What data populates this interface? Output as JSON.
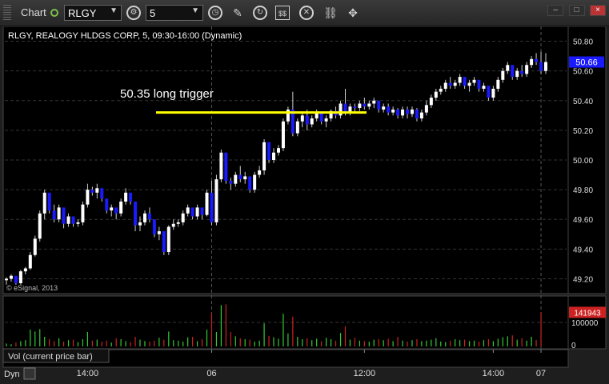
{
  "toolbar": {
    "chart_label": "Chart",
    "symbol": "RLGY",
    "interval": "5",
    "icons": [
      "settings-gear-icon",
      "clock-icon",
      "pencil-icon",
      "refresh-icon",
      "quote-icon",
      "close-circle-icon",
      "link-icon"
    ]
  },
  "window_buttons": [
    "–",
    "□",
    "×"
  ],
  "chart_data": {
    "type": "candlestick",
    "title": "RLGY, REALOGY HLDGS CORP, 5, 09:30-16:00 (Dynamic)",
    "annotation": "50.35 long trigger",
    "trigger_price": 50.32,
    "copyright": "© eSignal, 2013",
    "last_price": "50.66",
    "last_price_value": 50.66,
    "ylim": [
      49.1,
      50.9
    ],
    "y_ticks": [
      "50.80",
      "50.60",
      "50.40",
      "50.20",
      "50.00",
      "49.80",
      "49.60",
      "49.40",
      "49.20"
    ],
    "x_ticks": [
      "14:00",
      "06",
      "12:00",
      "14:00",
      "07"
    ],
    "day_separators": [
      "06",
      "07"
    ],
    "colors": {
      "up": "#ffffff",
      "down": "#1a1aff",
      "trigger": "#ffff00",
      "last_price_box": "#1a1aff",
      "vol_up": "#33cc33",
      "vol_down": "#cc2222"
    },
    "candles": [
      [
        49.19,
        49.21,
        49.16,
        49.2
      ],
      [
        49.2,
        49.23,
        49.18,
        49.22
      ],
      [
        49.22,
        49.21,
        49.16,
        49.17
      ],
      [
        49.17,
        49.26,
        49.16,
        49.25
      ],
      [
        49.25,
        49.28,
        49.23,
        49.27
      ],
      [
        49.27,
        49.38,
        49.26,
        49.36
      ],
      [
        49.36,
        49.49,
        49.35,
        49.47
      ],
      [
        49.47,
        49.66,
        49.45,
        49.64
      ],
      [
        49.64,
        49.8,
        49.6,
        49.78
      ],
      [
        49.78,
        49.74,
        49.64,
        49.66
      ],
      [
        49.66,
        49.7,
        49.58,
        49.6
      ],
      [
        49.6,
        49.7,
        49.58,
        49.68
      ],
      [
        49.68,
        49.6,
        49.54,
        49.57
      ],
      [
        49.57,
        49.64,
        49.55,
        49.62
      ],
      [
        49.62,
        49.6,
        49.55,
        49.57
      ],
      [
        49.57,
        49.6,
        49.55,
        49.58
      ],
      [
        49.58,
        49.72,
        49.56,
        49.7
      ],
      [
        49.7,
        49.84,
        49.68,
        49.8
      ],
      [
        49.8,
        49.82,
        49.76,
        49.78
      ],
      [
        49.78,
        49.84,
        49.74,
        49.81
      ],
      [
        49.81,
        49.8,
        49.72,
        49.74
      ],
      [
        49.74,
        49.72,
        49.64,
        49.66
      ],
      [
        49.66,
        49.7,
        49.62,
        49.68
      ],
      [
        49.68,
        49.66,
        49.6,
        49.64
      ],
      [
        49.64,
        49.74,
        49.62,
        49.72
      ],
      [
        49.72,
        49.81,
        49.7,
        49.78
      ],
      [
        49.78,
        49.76,
        49.7,
        49.72
      ],
      [
        49.72,
        49.7,
        49.52,
        49.56
      ],
      [
        49.56,
        49.62,
        49.52,
        49.58
      ],
      [
        49.58,
        49.66,
        49.56,
        49.64
      ],
      [
        49.64,
        49.68,
        49.58,
        49.6
      ],
      [
        49.6,
        49.58,
        49.48,
        49.5
      ],
      [
        49.5,
        49.55,
        49.46,
        49.52
      ],
      [
        49.52,
        49.5,
        49.36,
        49.38
      ],
      [
        49.38,
        49.56,
        49.36,
        49.55
      ],
      [
        49.55,
        49.6,
        49.53,
        49.57
      ],
      [
        49.57,
        49.6,
        49.55,
        49.58
      ],
      [
        49.58,
        49.66,
        49.56,
        49.64
      ],
      [
        49.64,
        49.7,
        49.62,
        49.68
      ],
      [
        49.68,
        49.66,
        49.6,
        49.62
      ],
      [
        49.62,
        49.7,
        49.6,
        49.68
      ],
      [
        49.68,
        49.66,
        49.6,
        49.63
      ],
      [
        49.63,
        49.8,
        49.62,
        49.78
      ],
      [
        49.78,
        49.86,
        49.56,
        49.58
      ],
      [
        49.58,
        49.9,
        49.56,
        49.87
      ],
      [
        49.87,
        50.07,
        49.85,
        50.05
      ],
      [
        50.05,
        50.0,
        49.84,
        49.86
      ],
      [
        49.86,
        49.88,
        49.8,
        49.84
      ],
      [
        49.84,
        49.92,
        49.82,
        49.9
      ],
      [
        49.9,
        49.96,
        49.85,
        49.87
      ],
      [
        49.87,
        49.92,
        49.84,
        49.89
      ],
      [
        49.89,
        49.84,
        49.78,
        49.8
      ],
      [
        49.8,
        49.92,
        49.78,
        49.9
      ],
      [
        49.9,
        49.96,
        49.88,
        49.93
      ],
      [
        49.93,
        50.14,
        49.9,
        50.12
      ],
      [
        50.12,
        50.1,
        49.98,
        50.0
      ],
      [
        50.0,
        50.08,
        49.98,
        50.05
      ],
      [
        50.05,
        50.1,
        50.03,
        50.08
      ],
      [
        50.08,
        50.28,
        50.06,
        50.26
      ],
      [
        50.26,
        50.36,
        50.24,
        50.34
      ],
      [
        50.34,
        50.46,
        50.16,
        50.18
      ],
      [
        50.18,
        50.28,
        50.16,
        50.26
      ],
      [
        50.26,
        50.32,
        50.22,
        50.3
      ],
      [
        50.3,
        50.34,
        50.2,
        50.24
      ],
      [
        50.24,
        50.3,
        50.22,
        50.28
      ],
      [
        50.28,
        50.34,
        50.26,
        50.32
      ],
      [
        50.32,
        50.3,
        50.24,
        50.26
      ],
      [
        50.26,
        50.3,
        50.22,
        50.28
      ],
      [
        50.28,
        50.34,
        50.26,
        50.33
      ],
      [
        50.33,
        50.36,
        50.28,
        50.3
      ],
      [
        50.3,
        50.4,
        50.28,
        50.38
      ],
      [
        50.38,
        50.48,
        50.3,
        50.32
      ],
      [
        50.32,
        50.38,
        50.3,
        50.36
      ],
      [
        50.36,
        50.38,
        50.32,
        50.35
      ],
      [
        50.35,
        50.4,
        50.33,
        50.38
      ],
      [
        50.38,
        50.42,
        50.34,
        50.36
      ],
      [
        50.36,
        50.4,
        50.34,
        50.38
      ],
      [
        50.38,
        50.42,
        50.35,
        50.4
      ],
      [
        50.4,
        50.38,
        50.32,
        50.34
      ],
      [
        50.34,
        50.38,
        50.32,
        50.36
      ],
      [
        50.36,
        50.38,
        50.3,
        50.32
      ],
      [
        50.32,
        50.36,
        50.3,
        50.34
      ],
      [
        50.34,
        50.35,
        50.28,
        50.3
      ],
      [
        50.3,
        50.36,
        50.28,
        50.34
      ],
      [
        50.34,
        50.36,
        50.28,
        50.31
      ],
      [
        50.31,
        50.36,
        50.29,
        50.34
      ],
      [
        50.34,
        50.35,
        50.26,
        50.28
      ],
      [
        50.28,
        50.34,
        50.26,
        50.32
      ],
      [
        50.32,
        50.4,
        50.3,
        50.37
      ],
      [
        50.37,
        50.44,
        50.35,
        50.42
      ],
      [
        50.42,
        50.48,
        50.4,
        50.46
      ],
      [
        50.46,
        50.5,
        50.44,
        50.48
      ],
      [
        50.48,
        50.54,
        50.46,
        50.52
      ],
      [
        50.52,
        50.56,
        50.48,
        50.5
      ],
      [
        50.5,
        50.54,
        50.48,
        50.52
      ],
      [
        50.52,
        50.58,
        50.5,
        50.56
      ],
      [
        50.56,
        50.55,
        50.48,
        50.5
      ],
      [
        50.5,
        50.54,
        50.46,
        50.52
      ],
      [
        50.52,
        50.56,
        50.5,
        50.54
      ],
      [
        50.54,
        50.52,
        50.46,
        50.48
      ],
      [
        50.48,
        50.52,
        50.46,
        50.5
      ],
      [
        50.5,
        50.48,
        50.4,
        50.42
      ],
      [
        50.42,
        50.5,
        50.4,
        50.48
      ],
      [
        50.48,
        50.56,
        50.46,
        50.54
      ],
      [
        50.54,
        50.62,
        50.52,
        50.6
      ],
      [
        50.6,
        50.66,
        50.58,
        50.64
      ],
      [
        50.64,
        50.62,
        50.54,
        50.56
      ],
      [
        50.56,
        50.62,
        50.54,
        50.6
      ],
      [
        50.6,
        50.64,
        50.56,
        50.58
      ],
      [
        50.58,
        50.66,
        50.56,
        50.64
      ],
      [
        50.64,
        50.7,
        50.62,
        50.68
      ],
      [
        50.68,
        50.72,
        50.64,
        50.66
      ],
      [
        50.66,
        50.73,
        50.58,
        50.6
      ],
      [
        50.6,
        50.72,
        50.58,
        50.66
      ]
    ],
    "volume_panel": {
      "label": "Vol (current price bar)",
      "last_value": "141943",
      "last_value_num": 141943,
      "ylim": [
        0,
        200000
      ],
      "y_ticks": [
        "100000",
        "0"
      ],
      "values": [
        12000,
        9000,
        16000,
        22000,
        26000,
        70000,
        62000,
        72000,
        40000,
        30000,
        22000,
        34000,
        20000,
        26000,
        28000,
        18000,
        30000,
        60000,
        24000,
        28000,
        20000,
        24000,
        16000,
        34000,
        30000,
        22000,
        18000,
        40000,
        28000,
        22000,
        20000,
        24000,
        36000,
        28000,
        62000,
        26000,
        24000,
        20000,
        38000,
        40000,
        22000,
        30000,
        70000,
        140000,
        60000,
        172000,
        175000,
        60000,
        42000,
        34000,
        30000,
        28000,
        20000,
        24000,
        96000,
        44000,
        38000,
        32000,
        136000,
        54000,
        124000,
        40000,
        30000,
        34000,
        26000,
        32000,
        22000,
        36000,
        30000,
        24000,
        56000,
        84000,
        28000,
        36000,
        24000,
        22000,
        20000,
        28000,
        30000,
        26000,
        32000,
        22000,
        40000,
        24000,
        20000,
        26000,
        30000,
        22000,
        24000,
        28000,
        34000,
        20000,
        18000,
        24000,
        30000,
        26000,
        28000,
        22000,
        24000,
        20000,
        26000,
        30000,
        22000,
        32000,
        38000,
        42000,
        46000,
        28000,
        34000,
        24000,
        40000,
        26000,
        141943
      ]
    }
  },
  "bottom": {
    "mode": "Dyn"
  }
}
